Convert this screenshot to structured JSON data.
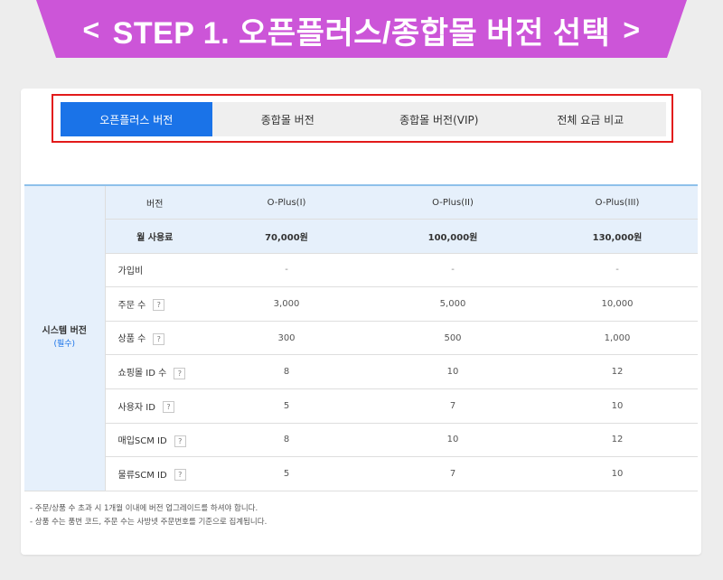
{
  "banner": {
    "title": "STEP 1. 오픈플러스/종합몰 버전 선택",
    "prev_glyph": "<",
    "next_glyph": ">",
    "color": "#cc55d8"
  },
  "tabs": [
    {
      "label": "오픈플러스 버전",
      "active": true
    },
    {
      "label": "종합몰 버전",
      "active": false
    },
    {
      "label": "종합몰 버전(VIP)",
      "active": false
    },
    {
      "label": "전체 요금 비교",
      "active": false
    }
  ],
  "table": {
    "group_label": "시스템 버전",
    "group_required": "(필수)",
    "header": {
      "label": "버전",
      "cols": [
        "O-Plus(I)",
        "O-Plus(II)",
        "O-Plus(III)"
      ]
    },
    "fee": {
      "label": "월 사용료",
      "cols": [
        "70,000원",
        "100,000원",
        "130,000원"
      ]
    },
    "rows": [
      {
        "label": "가입비",
        "help": false,
        "cols": [
          "-",
          "-",
          "-"
        ]
      },
      {
        "label": "주문 수",
        "help": true,
        "cols": [
          "3,000",
          "5,000",
          "10,000"
        ]
      },
      {
        "label": "상품 수",
        "help": true,
        "cols": [
          "300",
          "500",
          "1,000"
        ]
      },
      {
        "label": "쇼핑몰 ID 수",
        "help": true,
        "cols": [
          "8",
          "10",
          "12"
        ]
      },
      {
        "label": "사용자 ID",
        "help": true,
        "cols": [
          "5",
          "7",
          "10"
        ]
      },
      {
        "label": "매입SCM ID",
        "help": true,
        "cols": [
          "8",
          "10",
          "12"
        ]
      },
      {
        "label": "물류SCM ID",
        "help": true,
        "cols": [
          "5",
          "7",
          "10"
        ]
      }
    ],
    "help_glyph": "?"
  },
  "notes": [
    "- 주문/상품 수 초과 시 1개월 이내에 버전 업그레이드를 하셔야 합니다.",
    "- 상품 수는 품번 코드, 주문 수는 사방넷 주문번호를 기준으로 집계됩니다."
  ]
}
